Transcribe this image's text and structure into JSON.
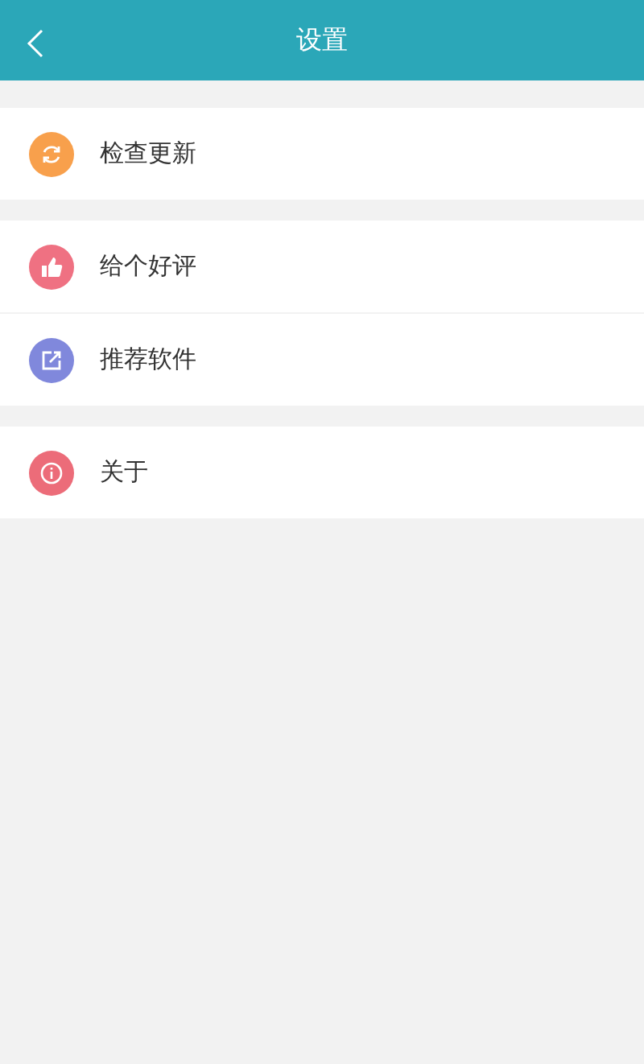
{
  "header": {
    "title": "设置"
  },
  "groups": [
    {
      "items": [
        {
          "label": "检查更新",
          "kind": "refresh",
          "color": "#f8a04c"
        }
      ]
    },
    {
      "items": [
        {
          "label": "给个好评",
          "kind": "thumb",
          "color": "#ef7182"
        },
        {
          "label": "推荐软件",
          "kind": "share",
          "color": "#8088dc"
        }
      ]
    },
    {
      "items": [
        {
          "label": "关于",
          "kind": "info",
          "color": "#ec6c79"
        }
      ]
    }
  ]
}
